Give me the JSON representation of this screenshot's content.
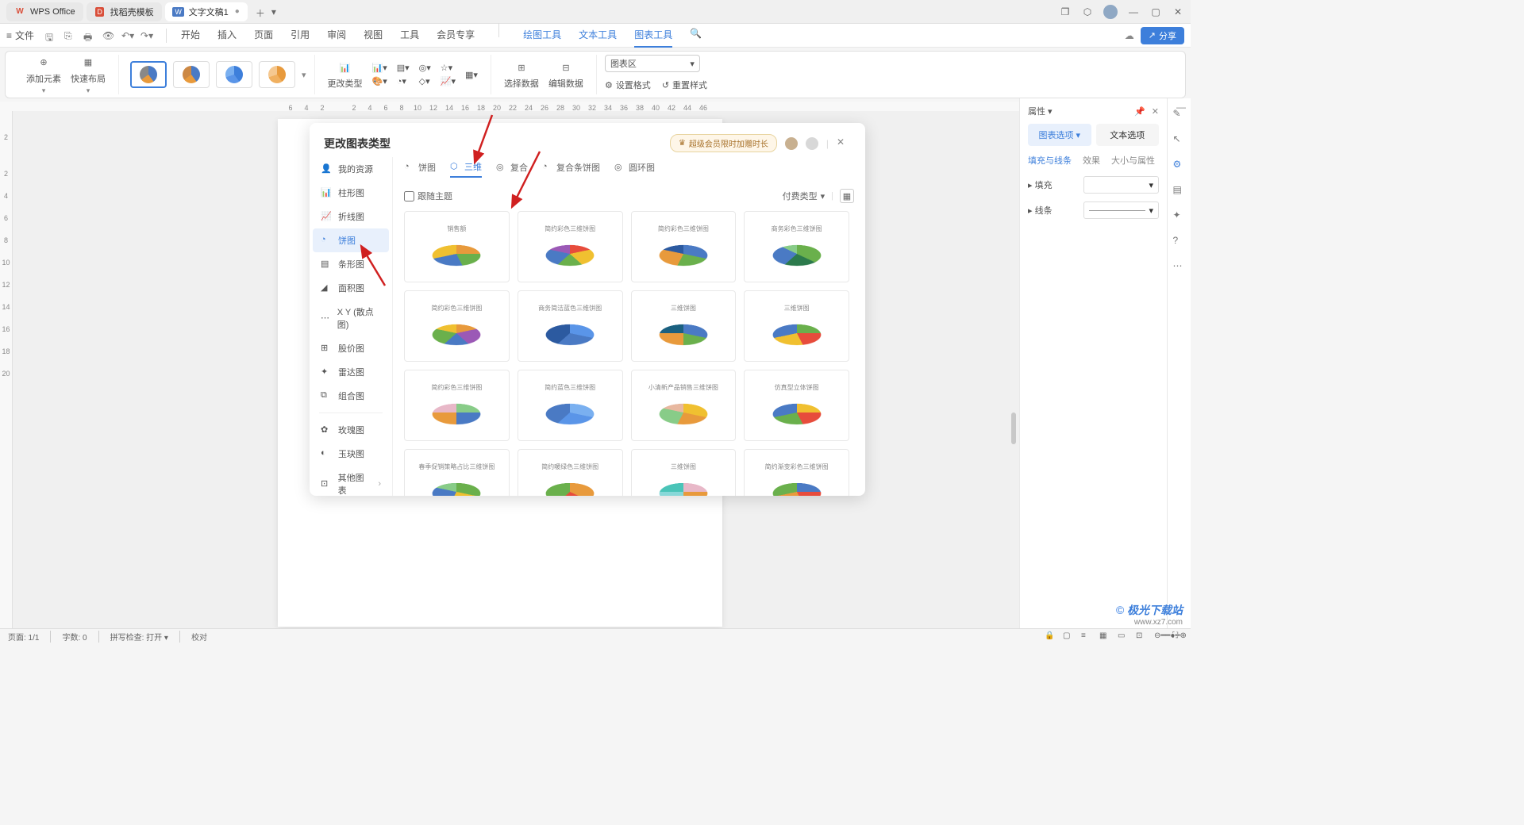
{
  "titlebar": {
    "tabs": [
      {
        "label": "WPS Office",
        "icon": "wps"
      },
      {
        "label": "找稻壳模板",
        "icon": "dn"
      },
      {
        "label": "文字文稿1",
        "icon": "w"
      }
    ]
  },
  "menubar": {
    "file": "文件",
    "tabs": [
      "开始",
      "插入",
      "页面",
      "引用",
      "审阅",
      "视图",
      "工具",
      "会员专享"
    ],
    "extra_tabs": [
      "绘图工具",
      "文本工具",
      "图表工具"
    ],
    "share": "分享"
  },
  "ribbon": {
    "add_element": "添加元素",
    "quick_layout": "快速布局",
    "change_type": "更改类型",
    "select_data": "选择数据",
    "edit_data": "编辑数据",
    "set_format": "设置格式",
    "reset_style": "重置样式",
    "area_select": "图表区"
  },
  "ruler_h": [
    "6",
    "4",
    "2",
    "",
    "2",
    "4",
    "6",
    "8",
    "10",
    "12",
    "14",
    "16",
    "18",
    "20",
    "22",
    "24",
    "26",
    "28",
    "30",
    "32",
    "34",
    "36",
    "38",
    "40",
    "42",
    "44",
    "46"
  ],
  "ruler_v": [
    "",
    "2",
    "",
    "2",
    "4",
    "6",
    "8",
    "10",
    "12",
    "14",
    "16",
    "18",
    "20"
  ],
  "dialog": {
    "title": "更改图表类型",
    "vip_badge": "超级会员限时加赠时长",
    "sidebar": [
      {
        "label": "我的资源",
        "icon": "user"
      },
      {
        "label": "柱形图",
        "icon": "bar"
      },
      {
        "label": "折线图",
        "icon": "line"
      },
      {
        "label": "饼图",
        "icon": "pie",
        "active": true
      },
      {
        "label": "条形图",
        "icon": "hbar"
      },
      {
        "label": "面积图",
        "icon": "area"
      },
      {
        "label": "X Y (散点图)",
        "icon": "scatter"
      },
      {
        "label": "股价图",
        "icon": "stock"
      },
      {
        "label": "雷达图",
        "icon": "radar"
      },
      {
        "label": "组合图",
        "icon": "combo"
      },
      {
        "label": "玫瑰图",
        "icon": "rose"
      },
      {
        "label": "玉玦图",
        "icon": "jade"
      },
      {
        "label": "其他图表",
        "icon": "other",
        "chevron": true
      }
    ],
    "subtabs": [
      "饼图",
      "三维",
      "复合",
      "复合条饼图",
      "圆环图"
    ],
    "follow_theme": "跟随主题",
    "pay_type": "付费类型",
    "templates": [
      "销售额",
      "简约彩色三维饼图",
      "简约彩色三维饼图",
      "商务彩色三维饼图",
      "简约彩色三维饼图",
      "商务简洁蓝色三维饼图",
      "三维饼图",
      "三维饼图",
      "简约彩色三维饼图",
      "简约蓝色三维饼图",
      "小清新产品销售三维饼图",
      "仿真型立体饼图",
      "春季促销策略占比三维饼图",
      "简约暖绿色三维饼图",
      "三维饼图",
      "简约渐变彩色三维饼图"
    ]
  },
  "properties": {
    "title": "属性",
    "chart_options": "图表选项",
    "text_options": "文本选项",
    "fill_line": "填充与线条",
    "effect": "效果",
    "size_prop": "大小与属性",
    "fill": "填充",
    "line": "线条"
  },
  "statusbar": {
    "page": "页面: 1/1",
    "words": "字数: 0",
    "spell": "拼写检查: 打开",
    "proof": "校对"
  },
  "watermark": {
    "site": "极光下载站",
    "url": "www.xz7.com"
  },
  "chart_data": {
    "type": "pie",
    "note": "Dialog shows 16 3D pie chart template thumbnails; each depicts multi-slice pies with varying color palettes. No explicit numeric data labels are readable beyond small percentage callouts in thumbnails.",
    "templates_count": 16
  }
}
